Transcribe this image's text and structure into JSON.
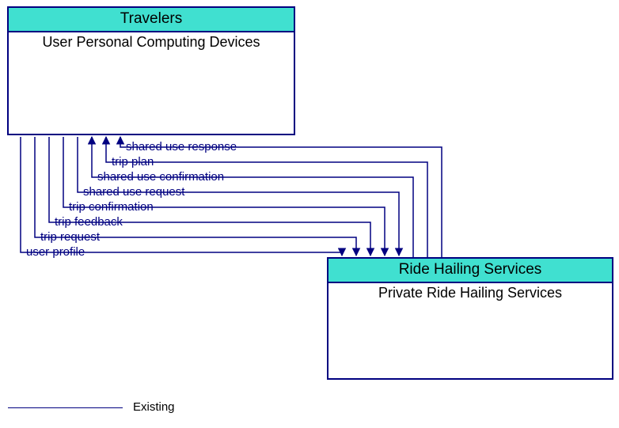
{
  "boxes": {
    "left": {
      "header": "Travelers",
      "body": "User Personal Computing Devices"
    },
    "right": {
      "header": "Ride Hailing Services",
      "body": "Private Ride Hailing Services"
    }
  },
  "flows": {
    "f1": "shared use response",
    "f2": "trip plan",
    "f3": "shared use confirmation",
    "f4": "shared use request",
    "f5": "trip confirmation",
    "f6": "trip feedback",
    "f7": "trip request",
    "f8": "user profile"
  },
  "legend": {
    "existing": "Existing"
  },
  "colors": {
    "line": "#000080",
    "header_bg": "#40e0d0"
  }
}
